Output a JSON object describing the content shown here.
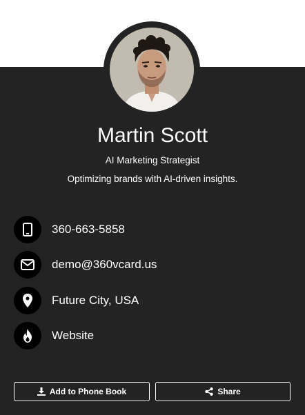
{
  "profile": {
    "name": "Martin Scott",
    "title": "AI Marketing Strategist",
    "tagline": "Optimizing brands with AI-driven insights."
  },
  "contacts": [
    {
      "icon": "phone-icon",
      "label": "360-663-5858"
    },
    {
      "icon": "mail-icon",
      "label": "demo@360vcard.us"
    },
    {
      "icon": "location-pin-icon",
      "label": "Future City, USA"
    },
    {
      "icon": "flame-icon",
      "label": "Website"
    }
  ],
  "actions": {
    "add_to_phone_book": "Add to Phone Book",
    "share": "Share"
  },
  "colors": {
    "card_background": "#232323",
    "icon_circle": "#000000",
    "text": "#ffffff",
    "page_background": "#ffffff"
  }
}
